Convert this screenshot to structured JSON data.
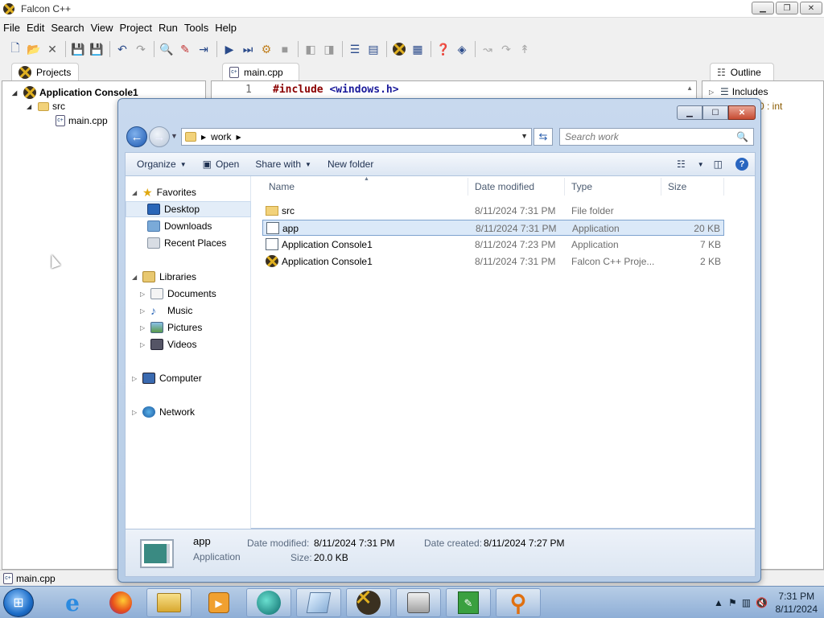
{
  "ide": {
    "title": "Falcon C++",
    "menu": [
      "File",
      "Edit",
      "Search",
      "View",
      "Project",
      "Run",
      "Tools",
      "Help"
    ],
    "projects_tab": "Projects",
    "tree": {
      "project": "Application Console1",
      "folder": "src",
      "file": "main.cpp"
    },
    "editor_tab": "main.cpp",
    "code": {
      "line_number": "1",
      "directive": "#include",
      "header": "<windows.h>"
    },
    "outline_tab": "Outline",
    "outline_item": "Includes",
    "outline_hint": "0 : int",
    "status_file": "main.cpp"
  },
  "explorer": {
    "address": {
      "crumb": "work"
    },
    "search_placeholder": "Search work",
    "commands": {
      "organize": "Organize",
      "open": "Open",
      "share_with": "Share with",
      "new_folder": "New folder"
    },
    "nav": {
      "favorites": "Favorites",
      "desktop": "Desktop",
      "downloads": "Downloads",
      "recent_places": "Recent Places",
      "libraries": "Libraries",
      "documents": "Documents",
      "music": "Music",
      "pictures": "Pictures",
      "videos": "Videos",
      "computer": "Computer",
      "network": "Network"
    },
    "columns": {
      "name": "Name",
      "date_modified": "Date modified",
      "type": "Type",
      "size": "Size"
    },
    "files": [
      {
        "name": "src",
        "date": "8/11/2024 7:31 PM",
        "type": "File folder",
        "size": ""
      },
      {
        "name": "app",
        "date": "8/11/2024 7:31 PM",
        "type": "Application",
        "size": "20 KB"
      },
      {
        "name": "Application Console1",
        "date": "8/11/2024 7:23 PM",
        "type": "Application",
        "size": "7 KB"
      },
      {
        "name": "Application Console1",
        "date": "8/11/2024 7:31 PM",
        "type": "Falcon C++ Proje...",
        "size": "2 KB"
      }
    ],
    "details": {
      "name": "app",
      "type": "Application",
      "date_modified_label": "Date modified:",
      "date_modified": "8/11/2024 7:31 PM",
      "date_created_label": "Date created:",
      "date_created": "8/11/2024 7:27 PM",
      "size_label": "Size:",
      "size": "20.0 KB"
    }
  },
  "taskbar": {
    "time": "7:31 PM",
    "date": "8/11/2024"
  }
}
